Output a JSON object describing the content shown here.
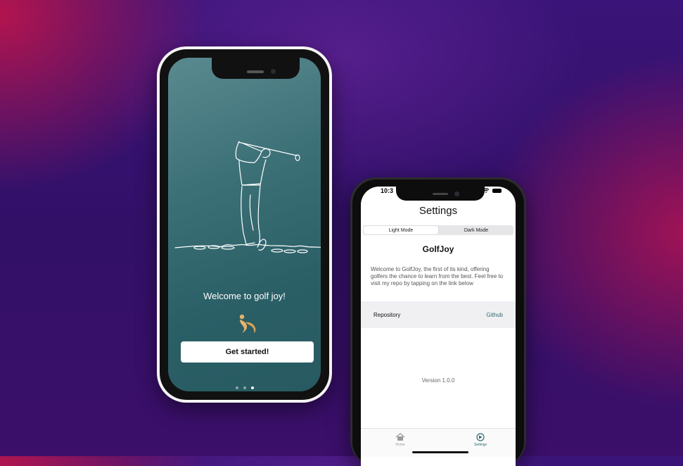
{
  "welcome_screen": {
    "welcome_text": "Welcome to golf joy!",
    "cta_label": "Get started!",
    "page_count": 3,
    "active_page": 3,
    "background_color": "#2b5f66"
  },
  "settings_screen": {
    "status_time": "10:3",
    "title": "Settings",
    "appearance_modes": [
      {
        "label": "Light Mode",
        "selected": true
      },
      {
        "label": "Dark Mode",
        "selected": false
      }
    ],
    "app_name": "GolfJoy",
    "about_text": "Welcome to GolfJoy, the first of its kind, offering golfers the chance to learn from the best. Feel free to visit my repo by tapping on the link below",
    "repository_label": "Repository",
    "repository_link_text": "Github",
    "version_text": "Version 1.0.0",
    "tabs": [
      {
        "label": "Home",
        "icon": "house-icon",
        "active": false
      },
      {
        "label": "Settings",
        "icon": "settings-icon",
        "active": true
      }
    ],
    "accent_color": "#2e6a6e"
  }
}
